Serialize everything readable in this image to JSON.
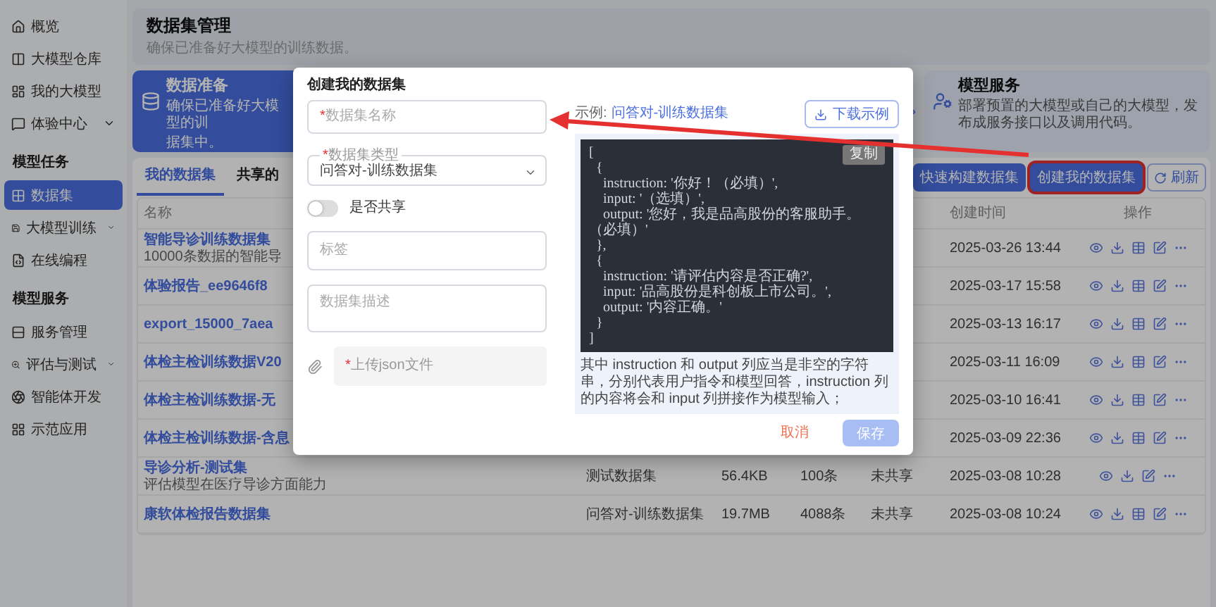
{
  "sidebar": {
    "groups": [
      {
        "items": [
          {
            "label": "概览",
            "selected": false,
            "expandable": false
          },
          {
            "label": "大模型仓库",
            "selected": false,
            "expandable": false
          },
          {
            "label": "我的大模型",
            "selected": false,
            "expandable": false
          },
          {
            "label": "体验中心",
            "selected": false,
            "expandable": true
          }
        ]
      },
      {
        "title": "模型任务",
        "items": [
          {
            "label": "数据集",
            "selected": true,
            "expandable": false
          },
          {
            "label": "大模型训练",
            "selected": false,
            "expandable": true
          },
          {
            "label": "在线编程",
            "selected": false,
            "expandable": false
          }
        ]
      },
      {
        "title": "模型服务",
        "items": [
          {
            "label": "服务管理",
            "selected": false,
            "expandable": false
          },
          {
            "label": "评估与测试",
            "selected": false,
            "expandable": true
          },
          {
            "label": "智能体开发",
            "selected": false,
            "expandable": false
          },
          {
            "label": "示范应用",
            "selected": false,
            "expandable": false
          }
        ]
      }
    ]
  },
  "header": {
    "title": "数据集管理",
    "subtitle": "确保已准备好大模型的训练数据。"
  },
  "steps": [
    {
      "title": "数据准备",
      "lines": [
        "确保已准备好大模型的训",
        "据集中。"
      ],
      "selected": true
    },
    {
      "title": "模型服务",
      "lines": [
        "部署预置的大模型或自己的大模型，发布成服务接口以及调用代码。"
      ],
      "selected": false
    }
  ],
  "tabs": [
    {
      "label": "我的数据集",
      "selected": true
    },
    {
      "label": "共享的",
      "selected": false
    }
  ],
  "buttons": [
    {
      "label": "快速构建数据集",
      "kind": "primary",
      "highlighted": false
    },
    {
      "label": "创建我的数据集",
      "kind": "primary",
      "highlighted": true
    },
    {
      "label": "刷新",
      "kind": "refresh",
      "highlighted": false
    }
  ],
  "table": {
    "columns": [
      "名称",
      "创建时间",
      "操作"
    ],
    "rows": [
      {
        "name": "智能导诊训练数据集",
        "desc": "10000条数据的智能导",
        "time": "2025-03-26 13:44",
        "actions": [
          {
            "kind": "view"
          },
          {
            "kind": "download"
          },
          {
            "kind": "fields"
          },
          {
            "kind": "edit"
          },
          {
            "kind": "more"
          }
        ]
      },
      {
        "name": "体验报告_ee9646f8",
        "time": "2025-03-17 15:58",
        "actions": [
          {
            "kind": "view"
          },
          {
            "kind": "download"
          },
          {
            "kind": "fields"
          },
          {
            "kind": "edit"
          },
          {
            "kind": "more"
          }
        ]
      },
      {
        "name": "export_15000_7aea",
        "time": "2025-03-13 16:17",
        "actions": [
          {
            "kind": "view"
          },
          {
            "kind": "download"
          },
          {
            "kind": "fields"
          },
          {
            "kind": "edit"
          },
          {
            "kind": "more"
          }
        ]
      },
      {
        "name": "体检主检训练数据V20",
        "time": "2025-03-11 16:09",
        "actions": [
          {
            "kind": "view"
          },
          {
            "kind": "download"
          },
          {
            "kind": "fields"
          },
          {
            "kind": "edit"
          },
          {
            "kind": "more"
          }
        ]
      },
      {
        "name": "体检主检训练数据-无",
        "time": "2025-03-10 16:41",
        "actions": [
          {
            "kind": "view"
          },
          {
            "kind": "download"
          },
          {
            "kind": "fields"
          },
          {
            "kind": "edit"
          },
          {
            "kind": "more"
          }
        ]
      },
      {
        "name": "体检主检训练数据-含息",
        "time": "2025-03-09 22:36",
        "actions": [
          {
            "kind": "view"
          },
          {
            "kind": "download"
          },
          {
            "kind": "fields"
          },
          {
            "kind": "edit"
          },
          {
            "kind": "more"
          }
        ]
      },
      {
        "name": "导诊分析-测试集",
        "desc": "评估模型在医疗导诊方面能力",
        "type": "测试数据集",
        "size": "56.4KB",
        "count": "100条",
        "share": "未共享",
        "time": "2025-03-08 10:28",
        "actions": [
          {
            "kind": "view"
          },
          {
            "kind": "download"
          },
          {
            "kind": "edit"
          },
          {
            "kind": "more"
          }
        ]
      },
      {
        "name": "康软体检报告数据集",
        "type": "问答对-训练数据集",
        "size": "19.7MB",
        "count": "4088条",
        "share": "未共享",
        "time": "2025-03-08 10:24",
        "actions": [
          {
            "kind": "view"
          },
          {
            "kind": "download"
          },
          {
            "kind": "fields"
          },
          {
            "kind": "edit"
          },
          {
            "kind": "more"
          }
        ]
      }
    ]
  },
  "modal": {
    "title": "创建我的数据集",
    "name_field": {
      "placeholder": "数据集名称",
      "mark": "*"
    },
    "type_field": {
      "label": "数据集类型",
      "mark": "*",
      "value": "问答对-训练数据集"
    },
    "share_switch": {
      "label": "是否共享",
      "on": false
    },
    "tag_field": {
      "placeholder": "标签"
    },
    "desc_field": {
      "placeholder": "数据集描述"
    },
    "upload": {
      "label": "上传json文件",
      "mark": "*"
    },
    "example_label": "示例:",
    "example_link": "问答对-训练数据集",
    "download_button": "下载示例",
    "copy_button": "复制",
    "code_lines": [
      "[",
      "  {",
      "    instruction: '你好！（必填）',",
      "    input: '（选填）',",
      "    output: '您好，我是品高股份的客服助手。（必填）'",
      "  },",
      "  {",
      "    instruction: '请评估内容是否正确?',",
      "    input: '品高股份是科创板上市公司。',",
      "    output: '内容正确。'",
      "  }",
      "]"
    ],
    "note": "其中 instruction 和 output 列应当是非空的字符串，分别代表用户指令和模型回答，instruction 列的内容将会和 input 列拼接作为模型输入；",
    "cancel": "取消",
    "save": "保存",
    "save_disabled": true
  }
}
